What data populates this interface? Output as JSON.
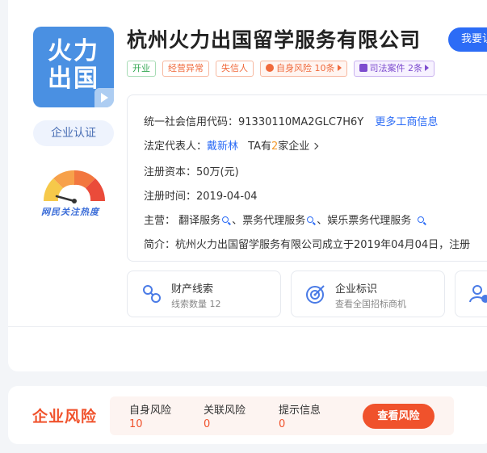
{
  "company": {
    "logo_text_line1": "火力",
    "logo_text_line2": "出国",
    "name": "杭州火力出国留学服务有限公司",
    "claim_button": "我要认",
    "certification": "企业认证",
    "heat_label": "网民关注热度"
  },
  "tags": {
    "status": "开业",
    "abnormal": "经营异常",
    "dishonest": "失信人",
    "self_risk": "自身风险 10条",
    "legal_cases": "司法案件 2条"
  },
  "info": {
    "credit_code_label": "统一社会信用代码：",
    "credit_code": "91330110MA2GLC7H6Y",
    "more_link": "更多工商信息",
    "legal_rep_label": "法定代表人：",
    "legal_rep": "戴新林",
    "ta_prefix": "TA有",
    "ta_count": "2",
    "ta_suffix": "家企业",
    "capital_label": "注册资本：",
    "capital": "50万(元)",
    "reg_date_label": "注册时间：",
    "reg_date": "2019-04-04",
    "business_label": "主营：",
    "business_1": "翻译服务",
    "business_2": "票务代理服务",
    "business_3": "娱乐票务代理服务",
    "sep": "、",
    "intro_label": "简介：",
    "intro": "杭州火力出国留学服务有限公司成立于2019年04月04日，注册"
  },
  "features": [
    {
      "title": "财产线索",
      "subtitle": "线索数量 12",
      "icon": "link-icon"
    },
    {
      "title": "企业标识",
      "subtitle": "查看全国招标商机",
      "icon": "target-icon"
    },
    {
      "title": "",
      "subtitle": "",
      "icon": "person-icon"
    }
  ],
  "risk": {
    "title": "企业风险",
    "self_label": "自身风险",
    "self_value": "10",
    "related_label": "关联风险",
    "related_value": "0",
    "hint_label": "提示信息",
    "hint_value": "0",
    "button": "查看风险"
  },
  "colors": {
    "accent": "#2c6cf6",
    "risk": "#f0522c",
    "logo_bg": "#4a90e2"
  }
}
